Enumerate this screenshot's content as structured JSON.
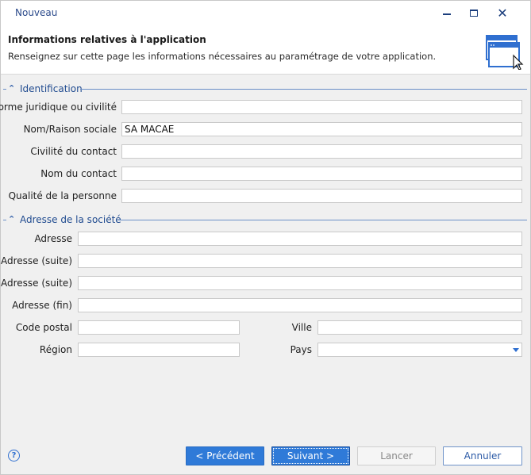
{
  "window": {
    "title": "Nouveau"
  },
  "header": {
    "title": "Informations relatives à l'application",
    "subtitle": "Renseignez sur cette page les informations nécessaires au paramétrage de votre application."
  },
  "identification": {
    "section_label": "Identification",
    "forme_label": "Forme juridique ou civilité",
    "forme_value": "",
    "nom_raison_label": "Nom/Raison sociale",
    "nom_raison_value": "SA MACAE",
    "civilite_label": "Civilité du contact",
    "civilite_value": "",
    "nom_contact_label": "Nom du contact",
    "nom_contact_value": "",
    "qualite_label": "Qualité de la personne",
    "qualite_value": ""
  },
  "adresse": {
    "section_label": "Adresse de la société",
    "adresse_label": "Adresse",
    "adresse_value": "",
    "adresse_suite1_label": "Adresse (suite)",
    "adresse_suite1_value": "",
    "adresse_suite2_label": "Adresse (suite)",
    "adresse_suite2_value": "",
    "adresse_fin_label": "Adresse (fin)",
    "adresse_fin_value": "",
    "code_postal_label": "Code postal",
    "code_postal_value": "",
    "ville_label": "Ville",
    "ville_value": "",
    "region_label": "Région",
    "region_value": "",
    "pays_label": "Pays",
    "pays_value": ""
  },
  "buttons": {
    "precedent": "< Précédent",
    "suivant": "Suivant >",
    "lancer": "Lancer",
    "annuler": "Annuler",
    "help": "?"
  },
  "colors": {
    "accent": "#2f7ad8",
    "section_text": "#1f4a8f",
    "title_text": "#2b4a8b"
  },
  "icons": {
    "collapse": "chevron-up-icon",
    "header": "window-cursor-icon",
    "help": "help-icon",
    "close": "close-icon",
    "minimize": "minimize-icon",
    "maximize": "maximize-icon",
    "combo": "dropdown-arrow-icon"
  }
}
